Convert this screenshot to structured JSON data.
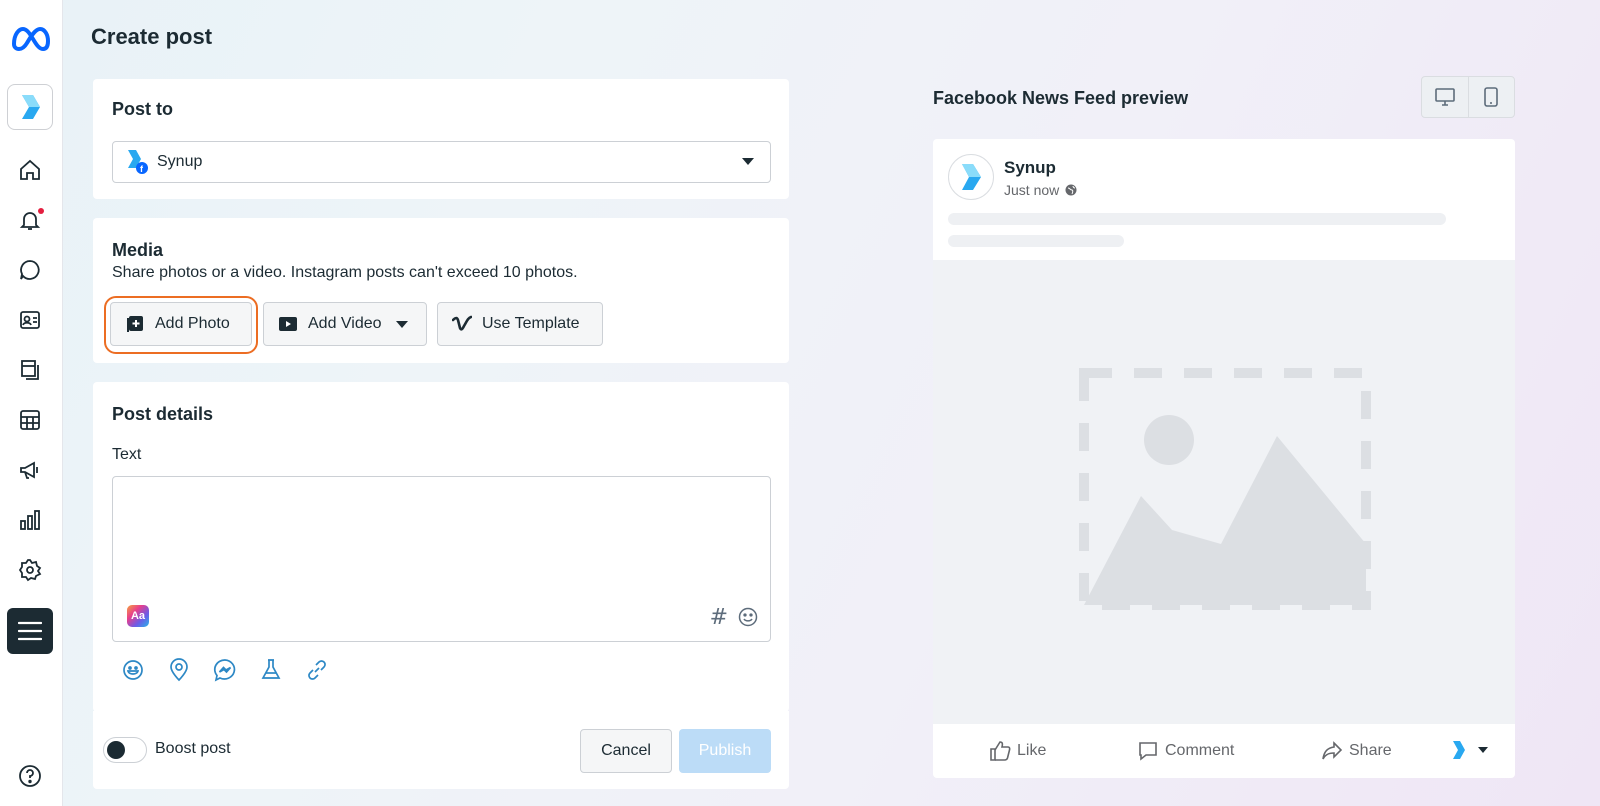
{
  "page": {
    "title": "Create post"
  },
  "sidebar": {
    "items": [
      "home-icon",
      "notifications-icon",
      "messages-icon",
      "contacts-icon",
      "content-icon",
      "planner-icon",
      "ads-icon",
      "insights-icon",
      "settings-icon",
      "all-tools-icon",
      "help-icon"
    ]
  },
  "post_to": {
    "title": "Post to",
    "selected_page": "Synup"
  },
  "media": {
    "title": "Media",
    "description": "Share photos or a video. Instagram posts can't exceed 10 photos.",
    "add_photo": "Add Photo",
    "add_video": "Add Video",
    "use_template": "Use Template"
  },
  "details": {
    "title": "Post details",
    "text_label": "Text",
    "text_value": "",
    "aa_label": "Aa",
    "hashtag": "#"
  },
  "footer": {
    "boost_label": "Boost post",
    "cancel": "Cancel",
    "publish": "Publish"
  },
  "preview": {
    "title": "Facebook News Feed preview",
    "page_name": "Synup",
    "time": "Just now",
    "like": "Like",
    "comment": "Comment",
    "share": "Share"
  },
  "colors": {
    "accent_highlight": "#ec6d23",
    "publish_disabled": "#bcdcf7",
    "meta_blue": "#0866ff",
    "synup_blue": "#29a8f0"
  }
}
